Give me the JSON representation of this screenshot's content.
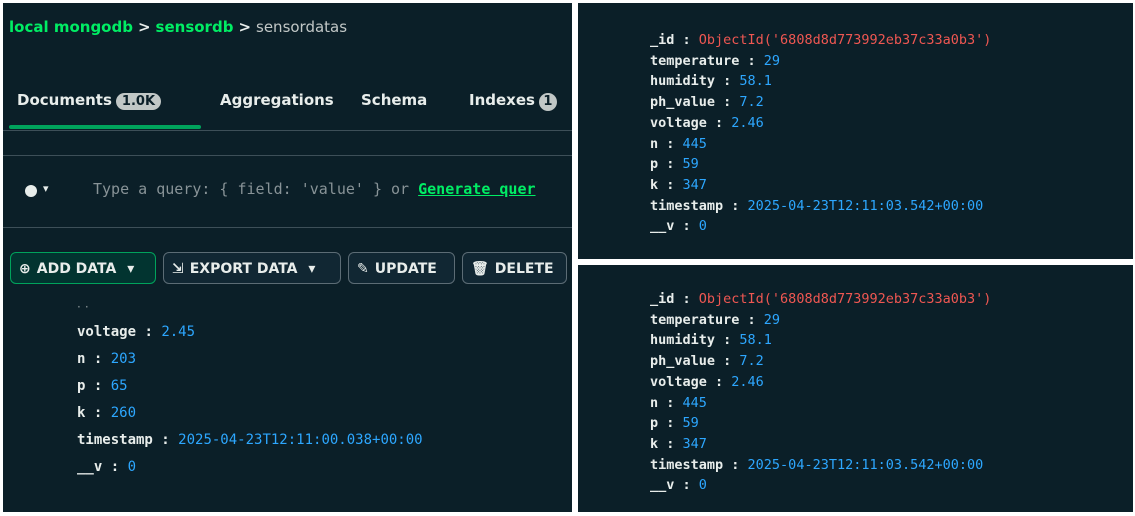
{
  "left": {
    "breadcrumb": {
      "connection": "local mongodb",
      "database": "sensordb",
      "collection": "sensordatas",
      "separator": ">"
    },
    "tabs": [
      {
        "label": "Documents",
        "badge": "1.0K"
      },
      {
        "label": "Aggregations"
      },
      {
        "label": "Schema"
      },
      {
        "label": "Indexes",
        "badge": "1"
      }
    ],
    "query": {
      "placeholder": "Type a query: { field: 'value' } or",
      "generate_link": "Generate quer"
    },
    "toolbar": {
      "add": "ADD DATA",
      "export": "EXPORT DATA",
      "update": "UPDATE",
      "delete": "DELETE"
    },
    "document": {
      "fields": [
        {
          "key": "voltage",
          "value": "2.45"
        },
        {
          "key": "n",
          "value": "203"
        },
        {
          "key": "p",
          "value": "65"
        },
        {
          "key": "k",
          "value": "260"
        },
        {
          "key": "timestamp",
          "value": "2025-04-23T12:11:00.038+00:00"
        },
        {
          "key": "__v",
          "value": "0"
        }
      ]
    }
  },
  "right_top": {
    "fields": [
      {
        "key": "_id",
        "value": "ObjectId('6808d8d773992eb37c33a0b3')"
      },
      {
        "key": "temperature",
        "value": "29"
      },
      {
        "key": "humidity",
        "value": "58.1"
      },
      {
        "key": "ph_value",
        "value": "7.2"
      },
      {
        "key": "voltage",
        "value": "2.46"
      },
      {
        "key": "n",
        "value": "445"
      },
      {
        "key": "p",
        "value": "59"
      },
      {
        "key": "k",
        "value": "347"
      },
      {
        "key": "timestamp",
        "value": "2025-04-23T12:11:03.542+00:00"
      },
      {
        "key": "__v",
        "value": "0"
      }
    ]
  },
  "right_bottom": {
    "fields": [
      {
        "key": "_id",
        "value": "ObjectId('6808d8d773992eb37c33a0b3')"
      },
      {
        "key": "temperature",
        "value": "29"
      },
      {
        "key": "humidity",
        "value": "58.1"
      },
      {
        "key": "ph_value",
        "value": "7.2"
      },
      {
        "key": "voltage",
        "value": "2.46"
      },
      {
        "key": "n",
        "value": "445"
      },
      {
        "key": "p",
        "value": "59"
      },
      {
        "key": "k",
        "value": "347"
      },
      {
        "key": "timestamp",
        "value": "2025-04-23T12:11:03.542+00:00"
      },
      {
        "key": "__v",
        "value": "0"
      }
    ]
  },
  "colors": {
    "bg": "#0b1f28",
    "key": "#e8edeb",
    "value": "#2da7ff",
    "objectid": "#ef5752",
    "accent": "#00ed64"
  }
}
